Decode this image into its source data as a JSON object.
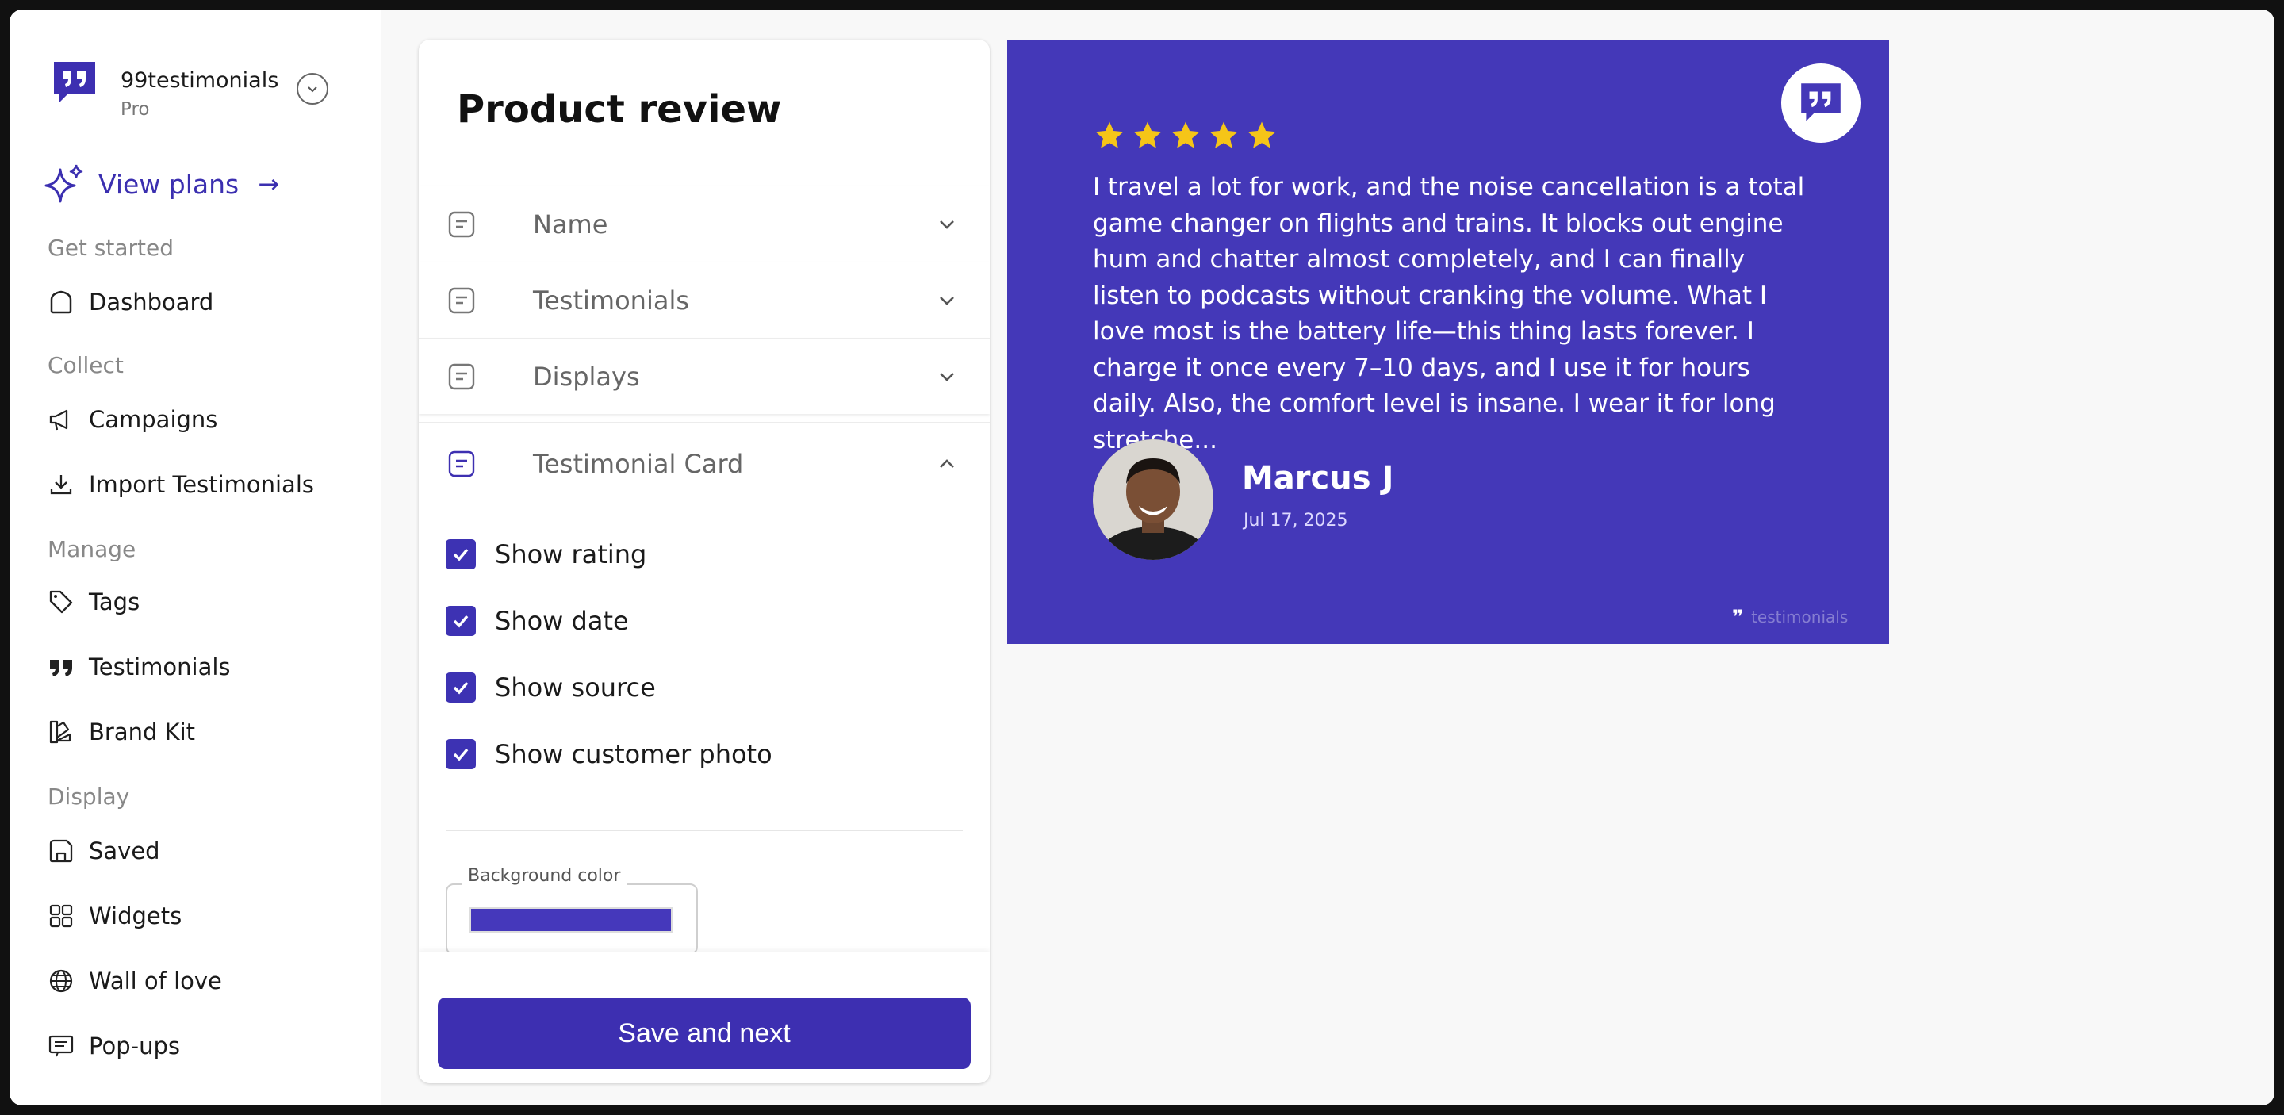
{
  "brand": {
    "name": "99testimonials",
    "plan": "Pro"
  },
  "view_plans_label": "View plans",
  "sidebar": {
    "sections": [
      {
        "label": "Get started"
      },
      {
        "label": "Collect"
      },
      {
        "label": "Manage"
      },
      {
        "label": "Display"
      }
    ],
    "items": [
      {
        "label": "Dashboard",
        "icon": "home-icon"
      },
      {
        "label": "Campaigns",
        "icon": "megaphone-icon"
      },
      {
        "label": "Import Testimonials",
        "icon": "download-icon"
      },
      {
        "label": "Tags",
        "icon": "tag-icon"
      },
      {
        "label": "Testimonials",
        "icon": "quote-icon"
      },
      {
        "label": "Brand Kit",
        "icon": "palette-icon"
      },
      {
        "label": "Saved",
        "icon": "save-icon"
      },
      {
        "label": "Widgets",
        "icon": "widgets-icon"
      },
      {
        "label": "Wall of love",
        "icon": "globe-icon"
      },
      {
        "label": "Pop-ups",
        "icon": "popup-icon"
      }
    ]
  },
  "editor": {
    "title": "Product review",
    "accordions": [
      {
        "label": "Name",
        "expanded": false
      },
      {
        "label": "Testimonials",
        "expanded": false
      },
      {
        "label": "Displays",
        "expanded": false
      },
      {
        "label": "Testimonial Card",
        "expanded": true
      }
    ],
    "options": [
      {
        "label": "Show rating",
        "checked": true
      },
      {
        "label": "Show date",
        "checked": true
      },
      {
        "label": "Show source",
        "checked": true
      },
      {
        "label": "Show customer photo",
        "checked": true
      }
    ],
    "background_color_label": "Background color",
    "background_color": "#4538bb",
    "save_label": "Save and next"
  },
  "preview": {
    "rating": 5,
    "rating_max": 5,
    "text": "I travel a lot for work, and the noise cancellation is a total game changer on flights and trains. It blocks out engine hum and chatter almost completely, and I can finally listen to podcasts without cranking the volume. What I love most is the battery life—this thing lasts forever. I charge it once every 7–10 days, and I use it for hours daily. Also, the comfort level is insane. I wear it for long stretche...",
    "customer_name": "Marcus J",
    "date": "Jul 17, 2025",
    "watermark": "testimonials"
  },
  "colors": {
    "accent": "#3d2fb1",
    "card_bg": "#4438b8",
    "star": "#f5c518"
  }
}
